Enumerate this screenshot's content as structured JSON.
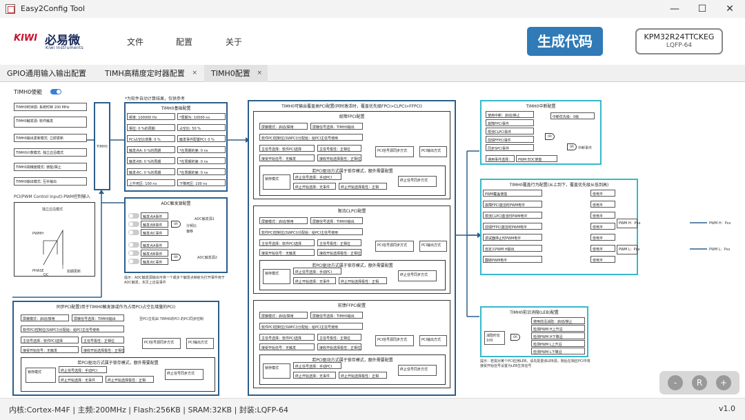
{
  "window": {
    "title": "Easy2Config Tool",
    "min": "—",
    "max": "☐",
    "close": "✕"
  },
  "brand": {
    "logo_en": "KIWI",
    "logo_cn": "必易微",
    "logo_sub": "Kiwi Instruments"
  },
  "menu": [
    "文件",
    "配置",
    "关于"
  ],
  "generate_label": "生成代码",
  "chip": {
    "name": "KPM32R24TTCKEG",
    "package": "LQFP-64"
  },
  "tabs": [
    {
      "label": "GPIO通用输入输出配置",
      "closable": false,
      "active": false
    },
    {
      "label": "TIMH高精度定时器配置",
      "closable": true,
      "active": false
    },
    {
      "label": "TIMH0配置",
      "closable": true,
      "active": true
    }
  ],
  "tab_close": "×",
  "timh0": {
    "enable_label": "TIMH0使能",
    "enabled": true
  },
  "left_rows": [
    "TIMH0时钟源:  系统时钟  200 MHz",
    "TIMH0触发源: 软件触发",
    "TIMH0输出更新模式: 立即更新",
    "TIMH0计数模式: 独立边沿模式",
    "TIMH0高精度模式: 使能/禁止",
    "TIMH0输出模式: 互补输出"
  ],
  "timh_block": "TIMH0",
  "pci_note": "PCI(PWM Control Input)-PWM控制输入",
  "wave": {
    "title": "独立边沿模式",
    "pwmh": "PWMH",
    "phase": "PHASE",
    "dc": "DC",
    "update": "如期更新"
  },
  "calc_note": "*为软件自动计算结果，仅供参考",
  "base": {
    "title": "TIMH0基础配置",
    "rows": [
      [
        "频率:",
        "100000",
        "Hz",
        "*周期为:",
        "10000",
        "ns"
      ],
      [
        "相位:",
        "0",
        "%的周期",
        "占空比:",
        "50",
        "%"
      ],
      [
        "PCI占空比增量:",
        "0",
        "%",
        "触发事件配置PCI:",
        "0",
        "%"
      ],
      [
        "触发点A:",
        "0",
        "%的周期",
        "*在周期的第:",
        "0",
        "ns"
      ],
      [
        "触发点B:",
        "0",
        "%的周期",
        "*在周期的第:",
        "0",
        "ns"
      ],
      [
        "触发点C:",
        "0",
        "%的周期",
        "*在周期的第:",
        "0",
        "ns"
      ],
      [
        "上升死区:",
        "100",
        "ns",
        "下降死区:",
        "100",
        "ns"
      ]
    ]
  },
  "adc": {
    "title": "ADC触发源配置",
    "items": [
      "触发点A事件",
      "触发点B事件",
      "触发点C事件",
      "触发点A事件",
      "触发点B事件",
      "触发点C事件"
    ],
    "trig1": "ADC触发源1",
    "trig2": "ADC触发源2",
    "div": "分频比",
    "delay": "偏移",
    "or": "OR",
    "note": "提示：ADC触发源输出可将一个或多个触发点映射为打开事件用于ADC触发，本页上还是事件"
  },
  "sync_pci": {
    "title": "同步PCI配置(用于TIMH0触发源或作为占用PCI占空比增量的PCI)",
    "rows": [
      "屏蔽模式：启动/禁用",
      "屏蔽信号选择：TIMH0输出",
      "主信号选择：软件PCI选择",
      "接受开始信号：无触发"
    ],
    "pci_label": "至PCI主机由 TIMH0的PCI 的PCI同步控制",
    "sw_label": "软件PCI控制位(SWPCI)分配给：给PCI主信号使用",
    "pol1": "主信号极性：正相位",
    "pol2": "接收开始选择极性：正相位",
    "gen": "PCI信号源同步方式",
    "out": "PCI输出方式",
    "sub": "若PCI驱动方式属于锁存模式，额外需要配置",
    "latch": "锁存模式",
    "term1": "终止信号选择：手动PCI",
    "term2": "终止开始选择：无事件",
    "term3": "终止开始选择极性：正相",
    "sync": "终止信号同步方式"
  },
  "pci_main": {
    "title": "TIMH0可输出覆盖类PCI配置(同时激活时，覆盖优先级FPCI>CLPCI>FFPCI)",
    "sections": [
      "故障FPCI配置",
      "限流CLPCI配置",
      "前馈FFPCI配置"
    ],
    "sub": "若PCI驱动方式属于锁存模式，额外需要配置"
  },
  "irq": {
    "title": "TIMH0中断配置",
    "rows": [
      "使用中断：启动/禁止",
      "故障FPCI事件",
      "限流CLPCI事件",
      "前馈FFPCI事件",
      "同步SPCI事件",
      "通用事件选择："
    ],
    "prio": "中断优先级：0级",
    "gate": "OR",
    "out": "中断事件",
    "evt": "PWM EOC使能"
  },
  "override": {
    "title": "TIMH0覆盖行为配置(从上到下，覆盖优先级从低到高)",
    "rows": [
      "PWM覆盖使能",
      "故障FPCI激活时PWM电平",
      "限流CLPCI激活时PWM电平",
      "前馈FFPCI激活时PWM电平",
      "调试器停止时PWM电平",
      "自定义PWM H输出",
      "翻转PWM电平"
    ],
    "val": "低电平",
    "pwmh": "PWM H：Pxx",
    "pwml": "PWM L：Pxx"
  },
  "leb": {
    "title": "TIMH0前沿消隐(LEB)配置",
    "rows": [
      "使用前沿消隐：启动/禁止",
      "检测PWM H上升沿",
      "检测PWM H下降沿",
      "检测PWM L上升沿",
      "检测PWM L下降沿"
    ],
    "time": "消隐时长",
    "time_val": "100",
    "unit": "ns",
    "or": "OR",
    "note": "提示：若需对某个PCI应用LEB，请先配置该LEB源，随后在相应PCI中将接受开始信号设置为LEB生效信号"
  },
  "zoom": {
    "minus": "-",
    "reset": "R",
    "plus": "+"
  },
  "footer": {
    "info": "内核:Cortex-M4F | 主频:200MHz | Flash:256KB | SRAM:32KB | 封装:LQFP-64",
    "version": "v1.0"
  },
  "colors": {
    "accent": "#2f7ab7",
    "cyan": "#35b8cc",
    "toggle": "#3a7fd5",
    "logo_red": "#c8102e"
  }
}
